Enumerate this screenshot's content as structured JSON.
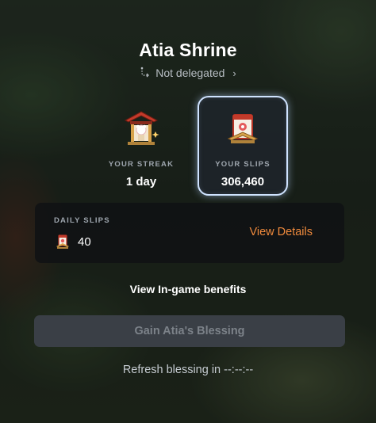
{
  "shrine": {
    "title": "Atia Shrine",
    "delegation_status": "Not delegated"
  },
  "stats": {
    "streak_label": "YOUR STREAK",
    "streak_value": "1 day",
    "slips_label": "YOUR SLIPS",
    "slips_value": "306,460"
  },
  "daily": {
    "label": "DAILY SLIPS",
    "count": "40",
    "details_link": "View Details"
  },
  "benefits_link": "View In-game benefits",
  "blessing_button": "Gain Atia's Blessing",
  "refresh_text": "Refresh blessing in --:--:--",
  "colors": {
    "accent_orange": "#f08a3c",
    "selected_border": "#cfe3ff",
    "disabled_button": "#3a3f46"
  },
  "icons": {
    "delegation": "delegate-arrows-icon",
    "streak": "shrine-icon",
    "slips": "slip-icon",
    "daily": "slip-icon",
    "chevron": "chevron-right-icon"
  }
}
